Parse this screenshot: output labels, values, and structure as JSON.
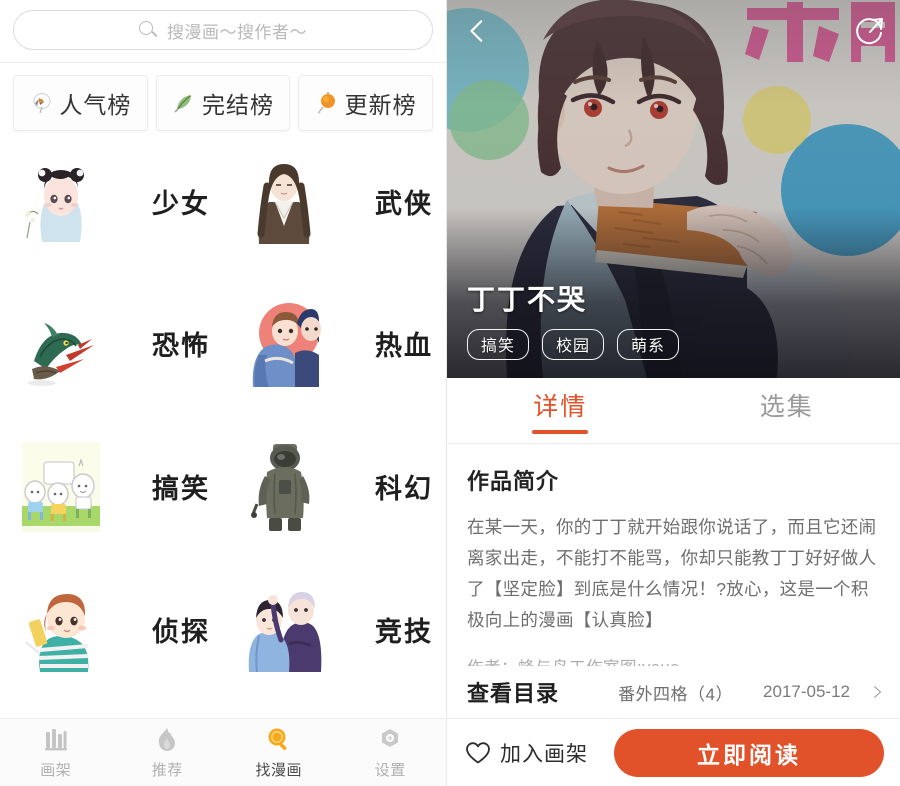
{
  "left": {
    "search": {
      "placeholder": "搜漫画～搜作者～",
      "value": "",
      "icon": "search-icon"
    },
    "ranks": [
      {
        "label": "人气榜",
        "icon": "popularity-badge-icon"
      },
      {
        "label": "完结榜",
        "icon": "leaf-icon"
      },
      {
        "label": "更新榜",
        "icon": "lantern-icon"
      }
    ],
    "categories": [
      {
        "name": "少女",
        "thumb": "girl-portrait-thumb"
      },
      {
        "name": "武侠",
        "thumb": "wuxia-man-thumb"
      },
      {
        "name": "恐怖",
        "thumb": "horror-dragon-thumb"
      },
      {
        "name": "热血",
        "thumb": "hotblood-duo-thumb"
      },
      {
        "name": "搞笑",
        "thumb": "comedy-chibi-thumb"
      },
      {
        "name": "科幻",
        "thumb": "scifi-astronaut-thumb"
      },
      {
        "name": "侦探",
        "thumb": "detective-kid-thumb"
      },
      {
        "name": "竞技",
        "thumb": "sports-duo-thumb"
      }
    ],
    "bottom_nav": {
      "active_color": "#F7A81B",
      "items": [
        {
          "label": "画架",
          "icon": "bookshelf-icon",
          "active": false
        },
        {
          "label": "推荐",
          "icon": "flame-icon",
          "active": false
        },
        {
          "label": "找漫画",
          "icon": "search-magnifier-icon",
          "active": true
        },
        {
          "label": "设置",
          "icon": "gear-icon",
          "active": false
        }
      ]
    }
  },
  "right": {
    "hero": {
      "title": "丁丁不哭",
      "tags": [
        "搞笑",
        "校园",
        "萌系"
      ],
      "cover_text": "不哭",
      "back_icon": "chevron-left-icon",
      "share_icon": "share-refresh-icon"
    },
    "tabs": [
      {
        "label": "详情",
        "active": true
      },
      {
        "label": "选集",
        "active": false
      }
    ],
    "detail": {
      "section_title": "作品简介",
      "description": "在某一天，你的丁丁就开始跟你说话了，而且它还闹离家出走，不能打不能骂，你却只能教丁丁好好做人了【坚定脸】到底是什么情况！?放心，这是一个积极向上的漫画【认真脸】",
      "author": "作者：蜂与鸟工作室图:yaua"
    },
    "catalog": {
      "label": "查看目录",
      "episode": "番外四格（4）",
      "date": "2017-05-12",
      "chevron": "chevron-right-icon"
    },
    "actions": {
      "favorite_label": "加入画架",
      "favorite_icon": "heart-outline-icon",
      "read_label": "立即阅读",
      "read_color": "#E2522A"
    }
  }
}
